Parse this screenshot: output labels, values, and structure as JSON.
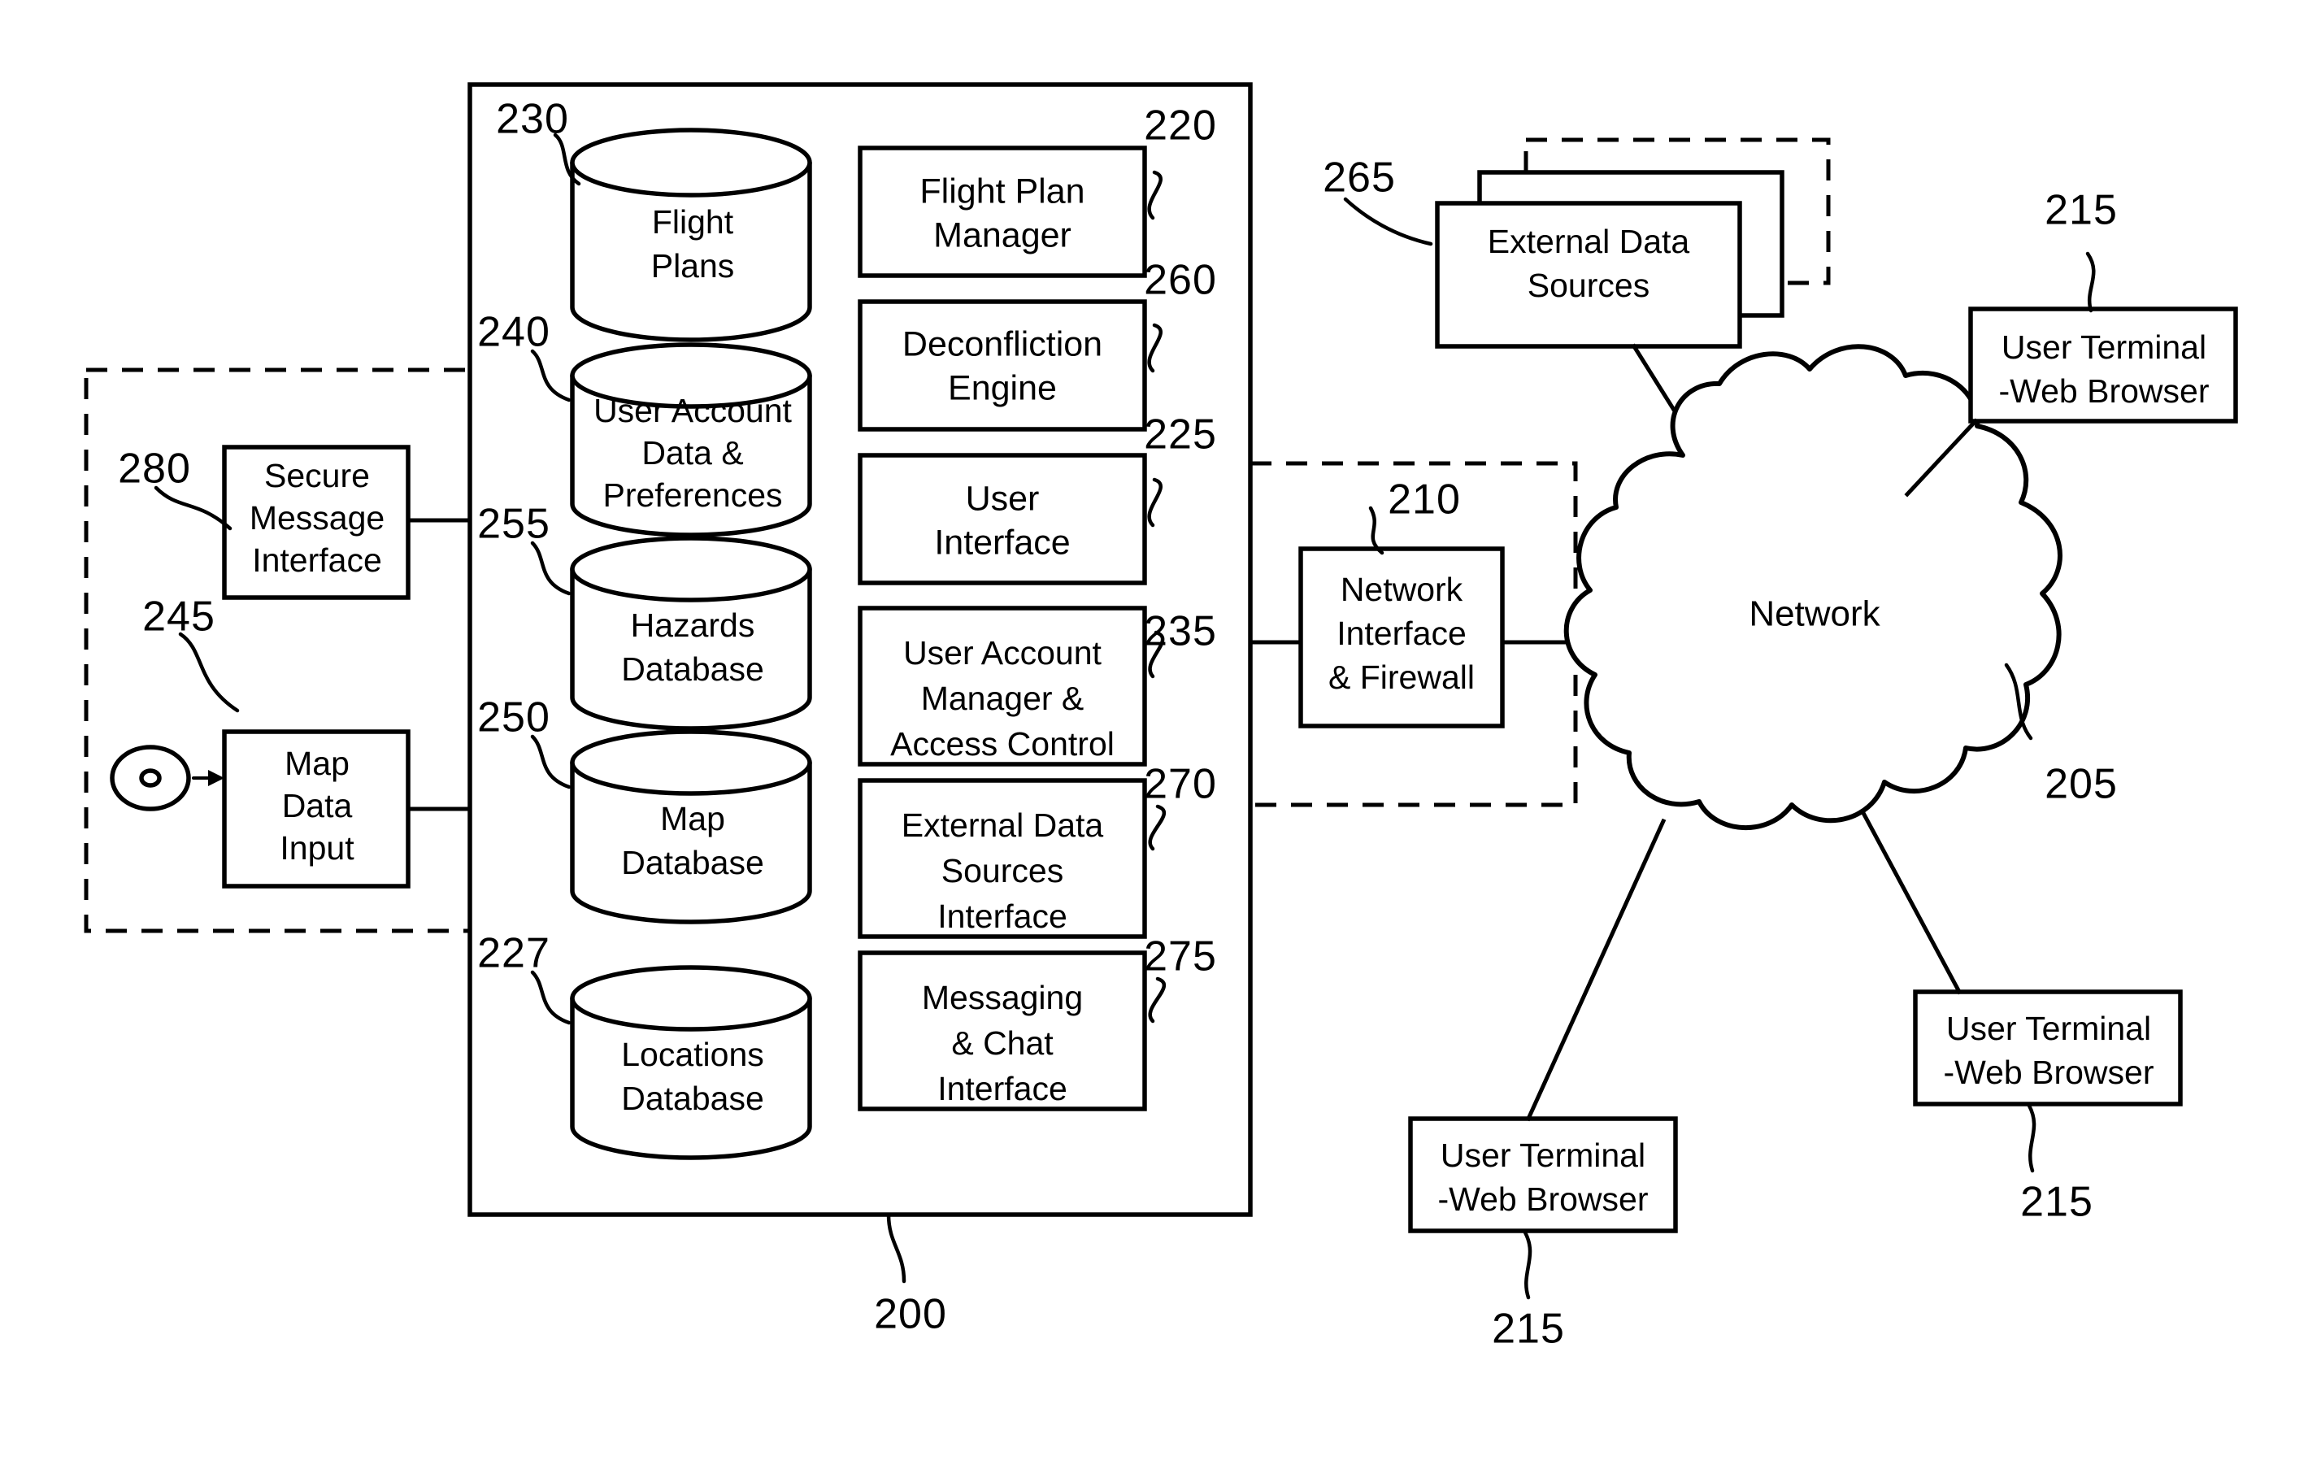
{
  "figure": {
    "type": "patent-system-block-diagram",
    "system_ref": "200"
  },
  "server": {
    "ref": "200",
    "databases": [
      {
        "ref": "230",
        "label_lines": [
          "Flight",
          "Plans"
        ],
        "name": "flight-plans-db"
      },
      {
        "ref": "240",
        "label_lines": [
          "User Account",
          "Data &",
          "Preferences"
        ],
        "name": "user-account-data-db"
      },
      {
        "ref": "255",
        "label_lines": [
          "Hazards",
          "Database"
        ],
        "name": "hazards-db"
      },
      {
        "ref": "250",
        "label_lines": [
          "Map",
          "Database"
        ],
        "name": "map-db"
      },
      {
        "ref": "227",
        "label_lines": [
          "Locations",
          "Database"
        ],
        "name": "locations-db"
      }
    ],
    "modules": [
      {
        "ref": "220",
        "label_lines": [
          "Flight Plan",
          "Manager"
        ],
        "name": "flight-plan-manager"
      },
      {
        "ref": "260",
        "label_lines": [
          "Deconfliction",
          "Engine"
        ],
        "name": "deconfliction-engine"
      },
      {
        "ref": "225",
        "label_lines": [
          "User",
          "Interface"
        ],
        "name": "user-interface"
      },
      {
        "ref": "235",
        "label_lines": [
          "User Account",
          "Manager &",
          "Access Control"
        ],
        "name": "user-account-manager"
      },
      {
        "ref": "270",
        "label_lines": [
          "External Data",
          "Sources",
          "Interface"
        ],
        "name": "external-data-sources-interface"
      },
      {
        "ref": "275",
        "label_lines": [
          "Messaging",
          "& Chat",
          "Interface"
        ],
        "name": "messaging-chat-interface"
      }
    ]
  },
  "left_group": {
    "secure_message_interface": {
      "ref": "280",
      "label_lines": [
        "Secure",
        "Message",
        "Interface"
      ]
    },
    "map_data_input": {
      "ref": "245",
      "label_lines": [
        "Map",
        "Data",
        "Input"
      ]
    },
    "disc_source_icon": "optical-disc-icon"
  },
  "right_group": {
    "network_interface": {
      "ref": "210",
      "label_lines": [
        "Network",
        "Interface",
        "& Firewall"
      ]
    }
  },
  "external_data_sources": {
    "ref": "265",
    "label_lines": [
      "External Data",
      "Sources"
    ],
    "stack_count": 3
  },
  "network": {
    "ref": "205",
    "label": "Network"
  },
  "user_terminals": [
    {
      "ref": "215",
      "label_lines": [
        "User Terminal",
        "-Web Browser"
      ],
      "position": "top-right"
    },
    {
      "ref": "215",
      "label_lines": [
        "User Terminal",
        "-Web Browser"
      ],
      "position": "bottom-right"
    },
    {
      "ref": "215",
      "label_lines": [
        "User Terminal",
        "-Web Browser"
      ],
      "position": "bottom-left"
    }
  ],
  "colors": {
    "ink": "#000000",
    "paper": "#ffffff"
  }
}
